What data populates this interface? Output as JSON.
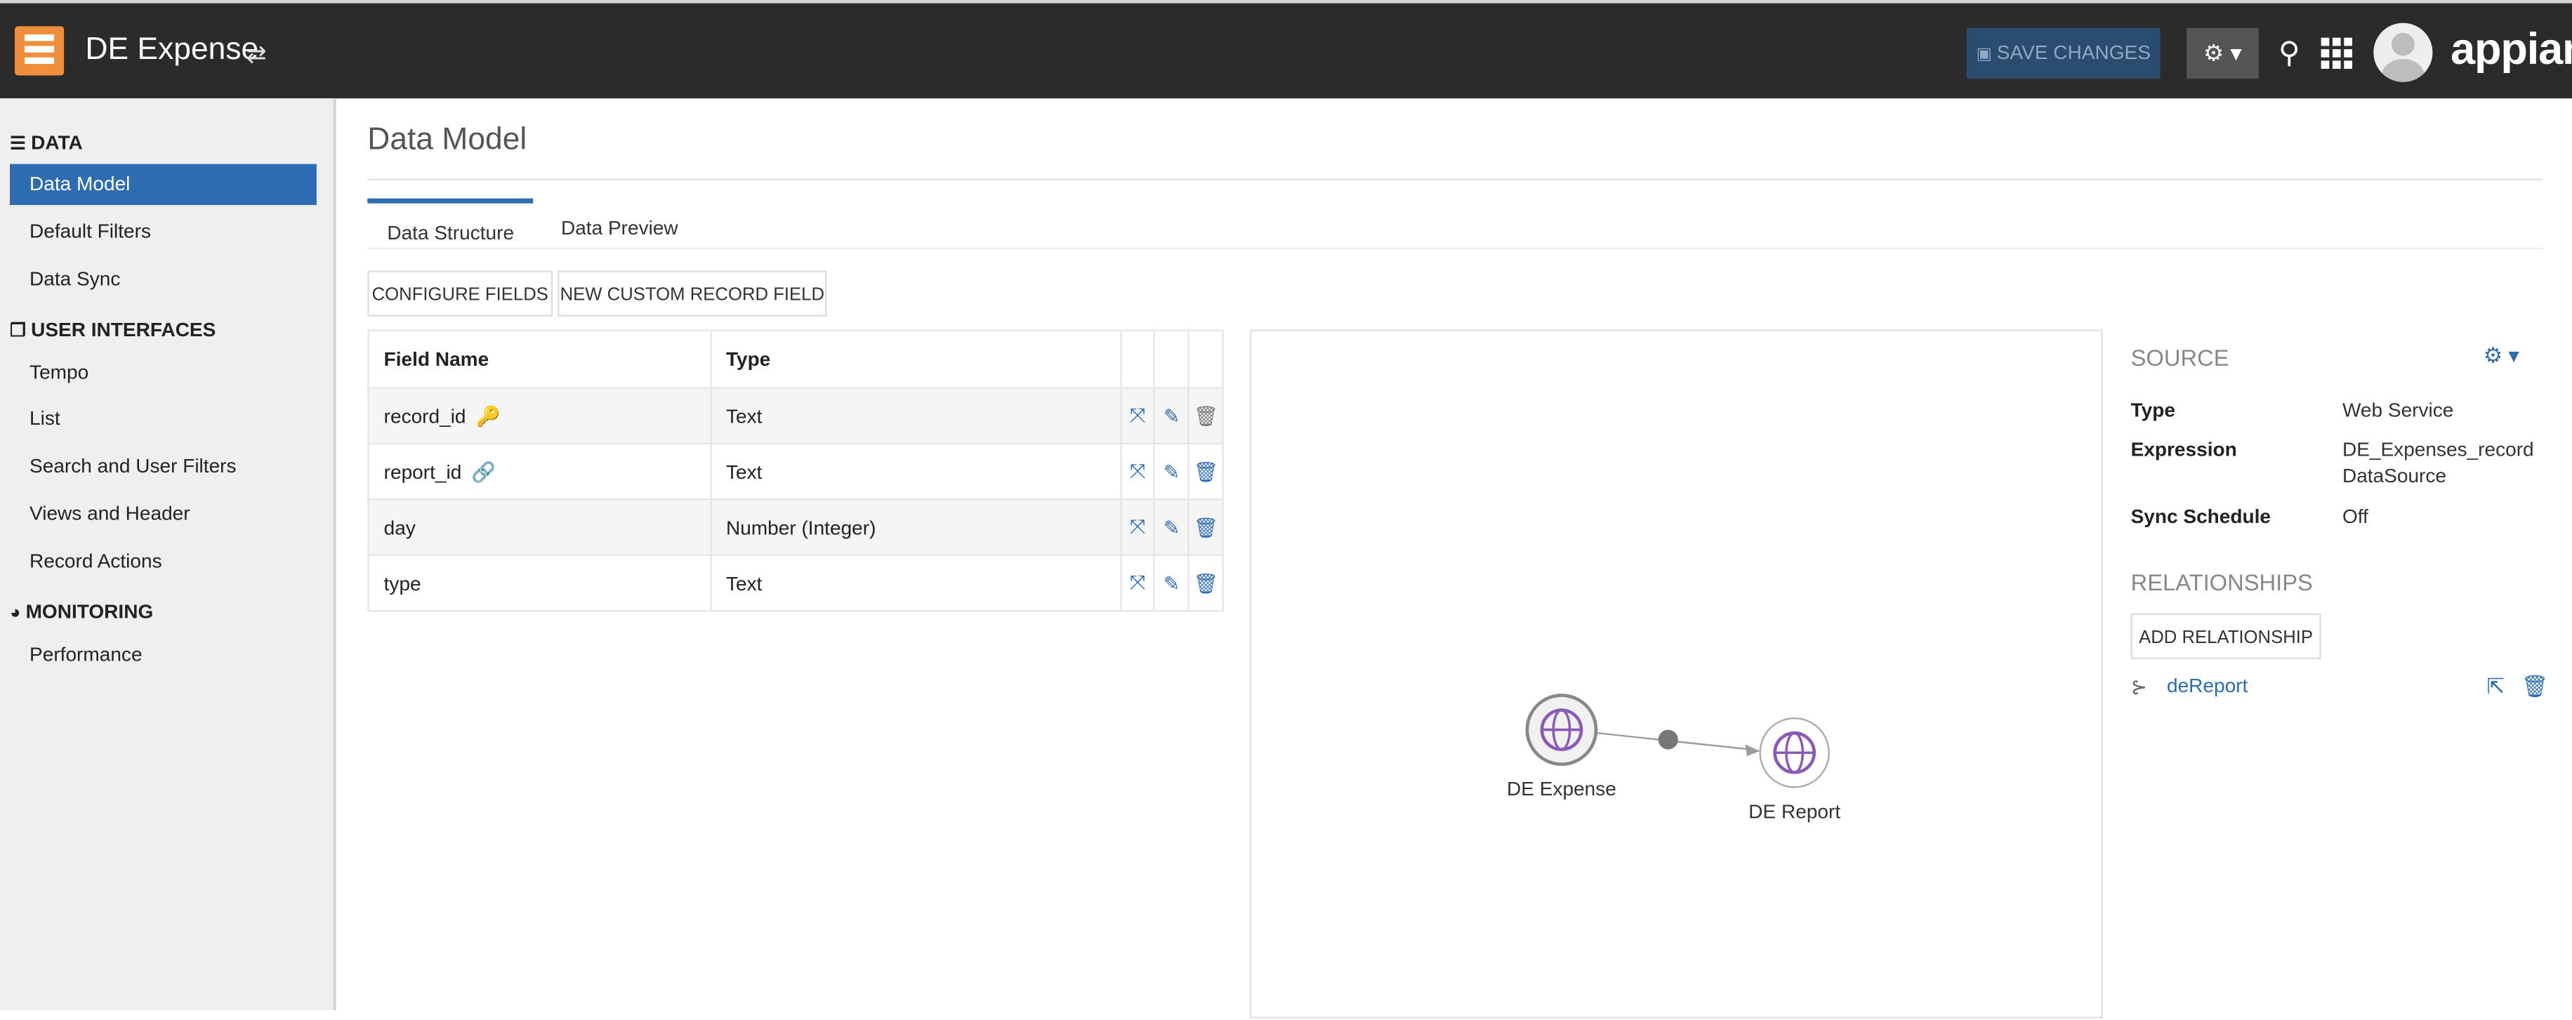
{
  "header": {
    "app_title": "DE Expense",
    "save_label": "SAVE CHANGES",
    "brand": "appian",
    "icons": [
      "app-logo-icon",
      "edit-link-icon",
      "save-disk-icon",
      "settings-gear-icon",
      "search-people-icon",
      "apps-grid-icon",
      "user-avatar-icon"
    ]
  },
  "sidebar": {
    "sections": [
      {
        "title": "DATA",
        "icon": "database-icon"
      },
      {
        "title": "USER INTERFACES",
        "icon": "copy-icon"
      },
      {
        "title": "MONITORING",
        "icon": "dashboard-icon"
      }
    ],
    "items": [
      {
        "label": "Data Model",
        "active": true
      },
      {
        "label": "Default Filters"
      },
      {
        "label": "Data Sync"
      },
      {
        "label": "Tempo"
      },
      {
        "label": "List"
      },
      {
        "label": "Search and User Filters"
      },
      {
        "label": "Views and Header"
      },
      {
        "label": "Record Actions"
      },
      {
        "label": "Performance"
      }
    ]
  },
  "main": {
    "title": "Data Model",
    "tabs": [
      {
        "label": "Data Structure",
        "active": true
      },
      {
        "label": "Data Preview"
      }
    ],
    "buttons": {
      "configure": "CONFIGURE FIELDS",
      "new_field": "NEW CUSTOM RECORD FIELD"
    },
    "table": {
      "headers": [
        "Field Name",
        "Type"
      ],
      "rows": [
        {
          "name": "record_id",
          "type": "Text",
          "badge": "key-icon"
        },
        {
          "name": "report_id",
          "type": "Text",
          "badge": "link-icon"
        },
        {
          "name": "day",
          "type": "Number (Integer)"
        },
        {
          "name": "type",
          "type": "Text"
        }
      ],
      "row_actions": [
        "relationship-icon",
        "edit-pencil-icon",
        "delete-trash-icon"
      ]
    },
    "diagram": {
      "nodes": [
        "DE Expense",
        "DE Report"
      ]
    }
  },
  "panel": {
    "source_heading": "SOURCE",
    "fields": [
      {
        "key": "Type",
        "value": "Web Service"
      },
      {
        "key": "Expression",
        "value": "DE_Expenses_record DataSource"
      },
      {
        "key": "Sync Schedule",
        "value": "Off"
      }
    ],
    "relationships_heading": "RELATIONSHIPS",
    "add_relationship": "ADD RELATIONSHIP",
    "relationship_name": "deReport"
  },
  "colors": {
    "accent": "#2d6cb0",
    "header_bg": "#2b2b2b",
    "logo": "#f08e3c",
    "node_purple": "#8b5ab5"
  }
}
